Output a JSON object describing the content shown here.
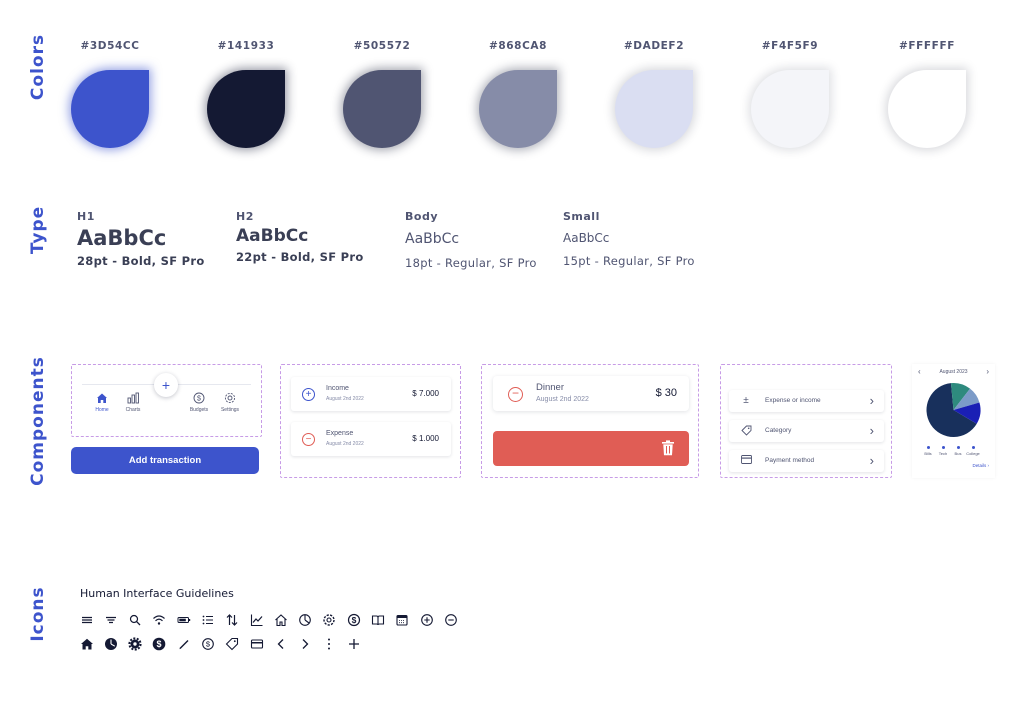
{
  "sections": {
    "colors": "Colors",
    "type": "Type",
    "components": "Components",
    "icons": "Icons"
  },
  "palette": [
    {
      "hex": "#3D54CC",
      "color": "#3D54CC",
      "glow": "rgba(61,84,204,0.55)"
    },
    {
      "hex": "#141933",
      "color": "#141933",
      "glow": "rgba(20,25,51,0.45)"
    },
    {
      "hex": "#505572",
      "color": "#505572",
      "glow": "rgba(20,25,51,0.40)"
    },
    {
      "hex": "#868CA8",
      "color": "#868CA8",
      "glow": "rgba(20,25,51,0.35)"
    },
    {
      "hex": "#DADEF2",
      "color": "#DADEF2",
      "glow": "rgba(20,25,51,0.18)"
    },
    {
      "hex": "#F4F5F9",
      "color": "#F4F5F9",
      "glow": "rgba(20,25,51,0.15)"
    },
    {
      "hex": "#FFFFFF",
      "color": "#FFFFFF",
      "glow": "rgba(20,25,51,0.18)"
    }
  ],
  "typography": [
    {
      "name": "H1",
      "sample": "AaBbCc",
      "desc": "28pt - Bold, SF Pro"
    },
    {
      "name": "H2",
      "sample": "AaBbCc",
      "desc": "22pt - Bold, SF Pro"
    },
    {
      "name": "Body",
      "sample": "AaBbCc",
      "desc": "18pt - Regular, SF Pro"
    },
    {
      "name": "Small",
      "sample": "AaBbCc",
      "desc": "15pt - Regular, SF Pro"
    }
  ],
  "tabbar": {
    "plus": "+",
    "tabs": [
      {
        "label": "Home",
        "icon": "house-icon"
      },
      {
        "label": "Charts",
        "icon": "chart-icon"
      },
      {
        "label": "Budgets",
        "icon": "dollar-icon"
      },
      {
        "label": "Settings",
        "icon": "gear-icon"
      }
    ]
  },
  "add_transaction": "Add transaction",
  "transactions": [
    {
      "name": "Income",
      "date": "August 2nd 2022",
      "amount": "$ 7.000",
      "type": "income"
    },
    {
      "name": "Expense",
      "date": "August 2nd 2022",
      "amount": "$ 1.000",
      "type": "expense"
    }
  ],
  "swipe_row": {
    "name": "Dinner",
    "date": "August 2nd 2022",
    "amount": "$ 30"
  },
  "form_rows": [
    {
      "label": "Expense or income",
      "icon": "plus-minus-icon"
    },
    {
      "label": "Category",
      "icon": "tag-icon"
    },
    {
      "label": "Payment method",
      "icon": "card-icon"
    }
  ],
  "chart_data": {
    "type": "pie",
    "title": "August 2023",
    "categories": [
      "Bills",
      "Tech",
      "Bus",
      "College"
    ],
    "values": [
      65,
      12,
      10,
      13
    ],
    "colors": [
      "#18305C",
      "#2E8A7E",
      "#7C9BC8",
      "#1A1FB5"
    ],
    "legend_placement": "bottom",
    "details_label": "Details"
  },
  "icons_title": "Human Interface Guidelines",
  "icon_row_1": [
    "menu-icon",
    "filter-icon",
    "search-icon",
    "wifi-icon",
    "battery-icon",
    "list-icon",
    "sort-icon",
    "chart-line-icon",
    "house-outline-icon",
    "pie-outline-icon",
    "gear-outline-icon",
    "dollar-outline-icon",
    "book-icon",
    "calendar-icon",
    "plus-circle-icon",
    "minus-circle-icon"
  ],
  "icon_row_2": [
    "house-fill-icon",
    "pie-fill-icon",
    "gear-fill-icon",
    "dollar-fill-icon",
    "pencil-icon",
    "dollar-circle-icon",
    "tag-icon",
    "card-icon",
    "chevron-left-icon",
    "chevron-right-icon",
    "more-vertical-icon",
    "plus-icon"
  ]
}
